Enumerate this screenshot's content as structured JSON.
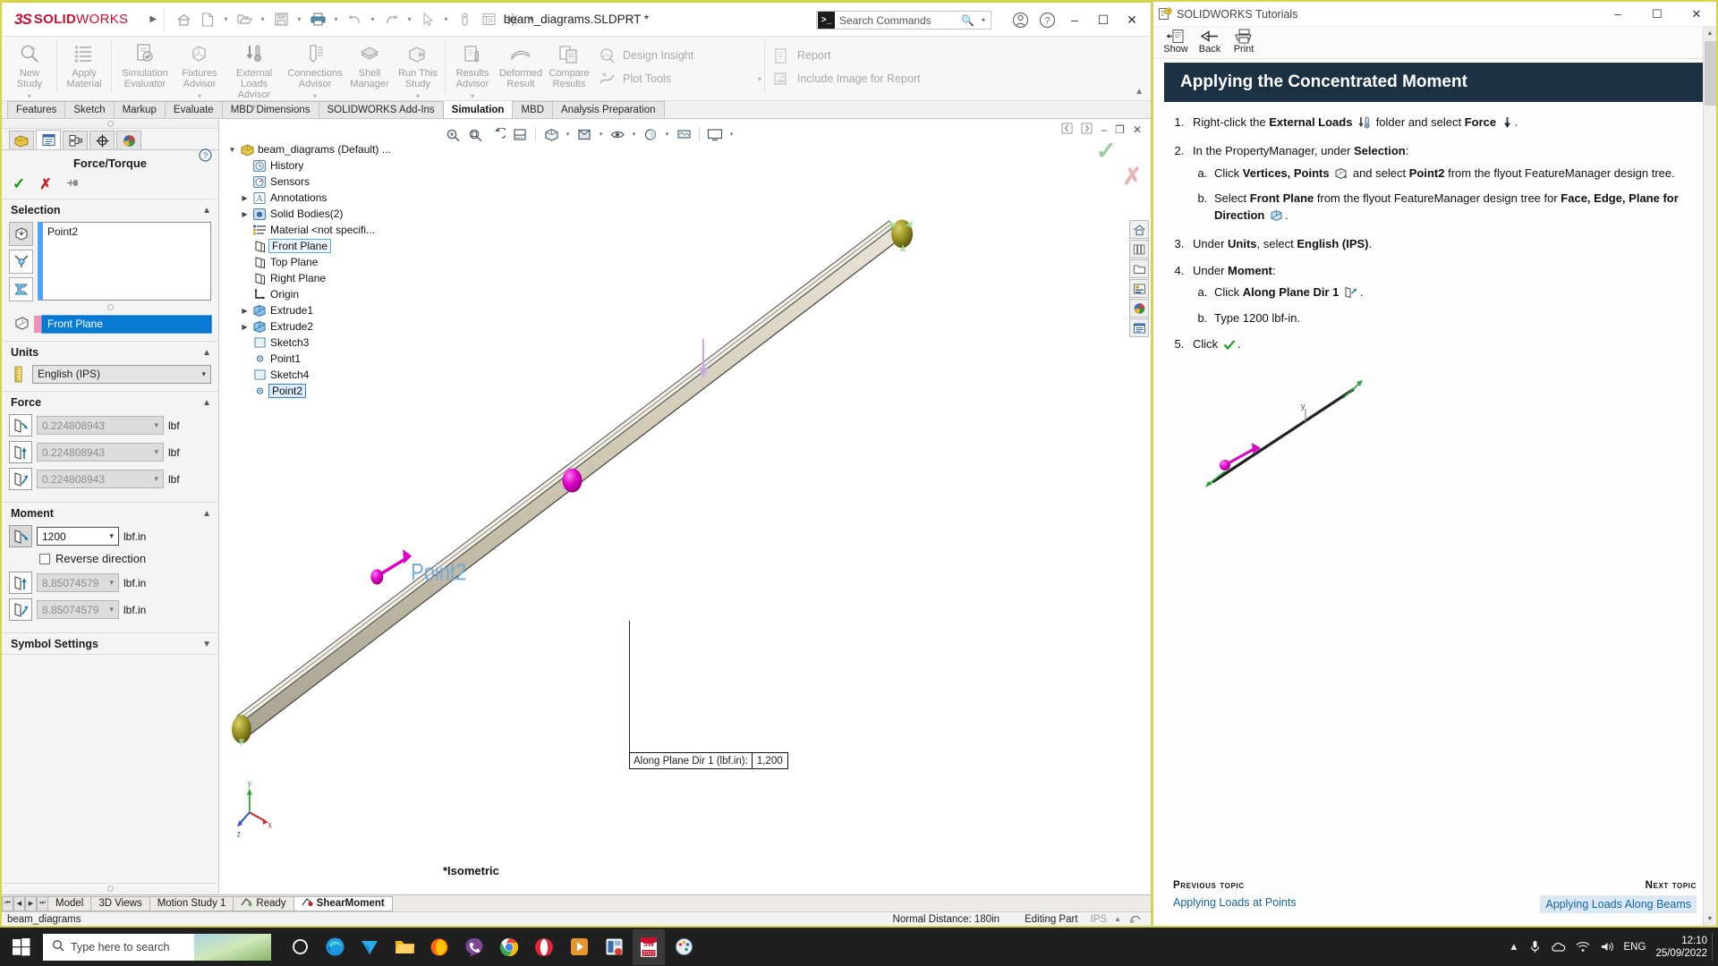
{
  "app": {
    "brand_ds": "23S",
    "brand_name": "SOLIDWORKS",
    "document_title": "beam_diagrams.SLDPRT *",
    "search_placeholder": "Search Commands"
  },
  "ribbon": {
    "items": [
      {
        "label": "New\nStudy",
        "icon": "new-study-icon",
        "dropdown": true
      },
      {
        "label": "Apply\nMaterial",
        "icon": "apply-material-icon",
        "dropdown": false
      },
      {
        "label": "Simulation\nEvaluator",
        "icon": "simulation-evaluator-icon",
        "dropdown": false
      },
      {
        "label": "Fixtures\nAdvisor",
        "icon": "fixtures-advisor-icon",
        "dropdown": true
      },
      {
        "label": "External Loads\nAdvisor",
        "icon": "external-loads-advisor-icon",
        "dropdown": true
      },
      {
        "label": "Connections\nAdvisor",
        "icon": "connections-advisor-icon",
        "dropdown": true
      },
      {
        "label": "Shell\nManager",
        "icon": "shell-manager-icon",
        "dropdown": false
      },
      {
        "label": "Run This\nStudy",
        "icon": "run-this-study-icon",
        "dropdown": true
      },
      {
        "label": "Results\nAdvisor",
        "icon": "results-advisor-icon",
        "dropdown": true
      },
      {
        "label": "Deformed\nResult",
        "icon": "deformed-result-icon",
        "dropdown": false
      },
      {
        "label": "Compare\nResults",
        "icon": "compare-results-icon",
        "dropdown": false
      }
    ],
    "stacked": [
      {
        "label": "Design Insight",
        "icon": "design-insight-icon"
      },
      {
        "label": "Plot Tools",
        "icon": "plot-tools-icon",
        "dropdown": true
      }
    ],
    "stacked2": [
      {
        "label": "Report",
        "icon": "report-icon"
      },
      {
        "label": "Include Image for Report",
        "icon": "include-image-icon"
      }
    ]
  },
  "command_tabs": {
    "items": [
      "Features",
      "Sketch",
      "Markup",
      "Evaluate",
      "MBD Dimensions",
      "SOLIDWORKS Add-Ins",
      "Simulation",
      "MBD",
      "Analysis Preparation"
    ],
    "active": "Simulation"
  },
  "property_manager": {
    "title": "Force/Torque",
    "sections": {
      "selection": {
        "label": "Selection",
        "selected_entity": "Point2",
        "direction_reference": "Front Plane"
      },
      "units": {
        "label": "Units",
        "value": "English (IPS)"
      },
      "force": {
        "label": "Force",
        "fields": [
          {
            "value": "0.224808943",
            "unit": "lbf",
            "icon": "normal-to-plane-icon",
            "enabled": false
          },
          {
            "value": "0.224808943",
            "unit": "lbf",
            "icon": "along-plane-dir2-icon",
            "enabled": false
          },
          {
            "value": "0.224808943",
            "unit": "lbf",
            "icon": "along-plane-dir1-icon",
            "enabled": false
          }
        ]
      },
      "moment": {
        "label": "Moment",
        "reverse_direction_label": "Reverse direction",
        "reverse_direction_checked": false,
        "fields": [
          {
            "value": "1200",
            "unit": "lbf.in",
            "icon": "along-plane-dir1-icon",
            "enabled": true
          },
          {
            "value": "8.85074579",
            "unit": "lbf.in",
            "icon": "along-plane-dir2-icon",
            "enabled": false
          },
          {
            "value": "8.85074579",
            "unit": "lbf.in",
            "icon": "normal-to-plane-icon",
            "enabled": false
          }
        ]
      },
      "symbol_settings": {
        "label": "Symbol Settings"
      }
    }
  },
  "feature_tree": [
    {
      "label": "beam_diagrams (Default) ...",
      "icon": "part-icon",
      "indent": 0,
      "caret": "down"
    },
    {
      "label": "History",
      "icon": "history-icon",
      "indent": 1,
      "caret": ""
    },
    {
      "label": "Sensors",
      "icon": "sensors-icon",
      "indent": 1,
      "caret": ""
    },
    {
      "label": "Annotations",
      "icon": "annotations-icon",
      "indent": 1,
      "caret": "right"
    },
    {
      "label": "Solid Bodies(2)",
      "icon": "solid-bodies-icon",
      "indent": 1,
      "caret": "right"
    },
    {
      "label": "Material <not specifi...",
      "icon": "material-icon",
      "indent": 1,
      "caret": ""
    },
    {
      "label": "Front Plane",
      "icon": "plane-icon",
      "indent": 1,
      "caret": "",
      "state": "highlight"
    },
    {
      "label": "Top Plane",
      "icon": "plane-icon",
      "indent": 1,
      "caret": ""
    },
    {
      "label": "Right Plane",
      "icon": "plane-icon",
      "indent": 1,
      "caret": ""
    },
    {
      "label": "Origin",
      "icon": "origin-icon",
      "indent": 1,
      "caret": ""
    },
    {
      "label": "Extrude1",
      "icon": "extrude-icon",
      "indent": 1,
      "caret": "right"
    },
    {
      "label": "Extrude2",
      "icon": "extrude-icon",
      "indent": 1,
      "caret": "right"
    },
    {
      "label": "Sketch3",
      "icon": "sketch-icon",
      "indent": 1,
      "caret": ""
    },
    {
      "label": "Point1",
      "icon": "point-icon",
      "indent": 1,
      "caret": ""
    },
    {
      "label": "Sketch4",
      "icon": "sketch-icon",
      "indent": 1,
      "caret": ""
    },
    {
      "label": "Point2",
      "icon": "point-icon",
      "indent": 1,
      "caret": "",
      "state": "selected"
    }
  ],
  "graphics": {
    "view_label": "*Isometric",
    "point_annotation": "Point2",
    "callout": {
      "label": "Along Plane Dir 1 (lbf.in):",
      "value": "1,200"
    }
  },
  "bottom_tabs": {
    "items": [
      "Model",
      "3D Views",
      "Motion Study 1"
    ],
    "study_tabs": [
      {
        "label": "Ready",
        "icon": "study-ready-icon"
      },
      {
        "label": "ShearMoment",
        "icon": "study-active-icon",
        "active": true
      }
    ]
  },
  "status_bar": {
    "left": "beam_diagrams",
    "normal_distance": "Normal Distance: 180in",
    "edit_mode": "Editing Part",
    "units": "IPS"
  },
  "tutorial": {
    "window_title": "SOLIDWORKS Tutorials",
    "toolbar": [
      {
        "label": "Show",
        "icon": "show-icon"
      },
      {
        "label": "Back",
        "icon": "back-arrow-icon"
      },
      {
        "label": "Print",
        "icon": "printer-icon"
      }
    ],
    "heading": "Applying the Concentrated Moment",
    "steps": [
      {
        "parts": [
          {
            "t": "Right-click the "
          },
          {
            "t": "External Loads",
            "b": true
          },
          {
            "t": " ",
            "icon": "external-loads-icon"
          },
          {
            "t": " folder and select "
          },
          {
            "t": "Force",
            "b": true
          },
          {
            "t": " ",
            "icon": "force-arrow-icon"
          },
          {
            "t": "."
          }
        ],
        "sub": []
      },
      {
        "parts": [
          {
            "t": "In the PropertyManager, under "
          },
          {
            "t": "Selection",
            "b": true
          },
          {
            "t": ":"
          }
        ],
        "sub": [
          {
            "parts": [
              {
                "t": "Click "
              },
              {
                "t": "Vertices, Points",
                "b": true
              },
              {
                "t": " ",
                "icon": "vertices-points-icon"
              },
              {
                "t": " and select "
              },
              {
                "t": "Point2",
                "b": true
              },
              {
                "t": " from the flyout FeatureManager design tree."
              }
            ]
          },
          {
            "parts": [
              {
                "t": "Select "
              },
              {
                "t": "Front Plane",
                "b": true
              },
              {
                "t": " from the flyout FeatureManager design tree for "
              },
              {
                "t": "Face, Edge, Plane for Direction",
                "b": true
              },
              {
                "t": " ",
                "icon": "plane-direction-icon"
              },
              {
                "t": "."
              }
            ]
          }
        ]
      },
      {
        "parts": [
          {
            "t": "Under "
          },
          {
            "t": "Units",
            "b": true
          },
          {
            "t": ", select "
          },
          {
            "t": "English (IPS)",
            "b": true
          },
          {
            "t": "."
          }
        ],
        "sub": []
      },
      {
        "parts": [
          {
            "t": "Under "
          },
          {
            "t": "Moment",
            "b": true
          },
          {
            "t": ":"
          }
        ],
        "sub": [
          {
            "parts": [
              {
                "t": "Click "
              },
              {
                "t": "Along Plane Dir 1",
                "b": true
              },
              {
                "t": " ",
                "icon": "along-plane-dir1-icon"
              },
              {
                "t": "."
              }
            ]
          },
          {
            "parts": [
              {
                "t": "Type "
              },
              {
                "t": "1200 lbf-in."
              }
            ]
          }
        ]
      },
      {
        "parts": [
          {
            "t": "Click "
          },
          {
            "t": " ",
            "icon": "green-check-icon"
          },
          {
            "t": "."
          }
        ],
        "sub": []
      }
    ],
    "footer": {
      "previous_title": "Previous topic",
      "previous_link": "Applying Loads at Points",
      "next_title": "Next topic",
      "next_link": "Applying Loads Along Beams"
    }
  },
  "taskbar": {
    "search_placeholder": "Type here to search",
    "apps": [
      {
        "name": "cortana-icon"
      },
      {
        "name": "edge-icon"
      },
      {
        "name": "telegram-icon"
      },
      {
        "name": "file-explorer-icon"
      },
      {
        "name": "firefox-icon"
      },
      {
        "name": "viber-icon"
      },
      {
        "name": "chrome-icon"
      },
      {
        "name": "opera-icon"
      },
      {
        "name": "media-player-icon"
      },
      {
        "name": "app-window-icon"
      },
      {
        "name": "solidworks-2022-icon",
        "active": true
      },
      {
        "name": "paint-icon"
      }
    ],
    "language": "ENG",
    "time": "12:10",
    "date": "25/09/2022"
  },
  "colors": {
    "accent_blue": "#0a7bd4",
    "brand_red": "#c8102e",
    "tutorial_header": "#1c3144",
    "window_border": "#d7d34a",
    "magenta": "#e000c8",
    "olive": "#878420"
  }
}
